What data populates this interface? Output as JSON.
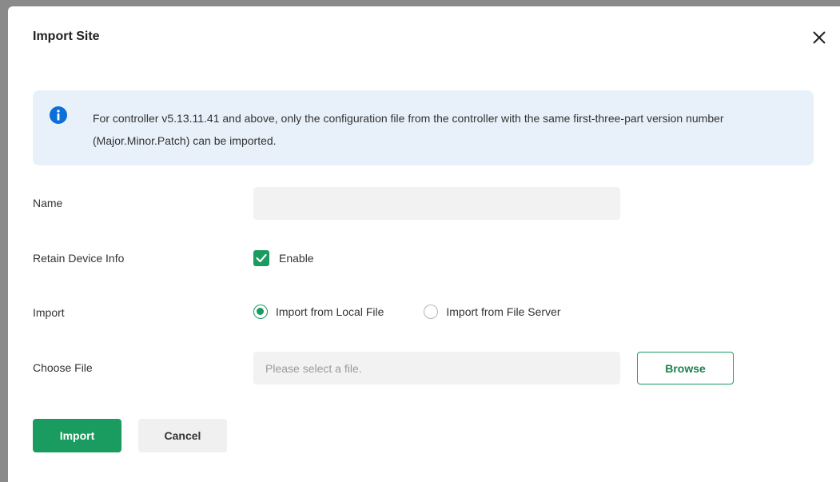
{
  "dialog": {
    "title": "Import Site",
    "close_icon": "close-icon"
  },
  "notice": {
    "icon": "info-icon",
    "text": "For controller v5.13.11.41 and above, only the configuration file from the controller with the same first-three-part version number (Major.Minor.Patch) can be imported."
  },
  "form": {
    "name": {
      "label": "Name",
      "value": "",
      "placeholder": ""
    },
    "retain_device_info": {
      "label": "Retain Device Info",
      "checkbox_label": "Enable",
      "checked": true
    },
    "import": {
      "label": "Import",
      "options": [
        {
          "label": "Import from Local File",
          "selected": true
        },
        {
          "label": "Import from File Server",
          "selected": false
        }
      ]
    },
    "choose_file": {
      "label": "Choose File",
      "placeholder": "Please select a file.",
      "value": "",
      "browse_label": "Browse"
    }
  },
  "footer": {
    "import_label": "Import",
    "cancel_label": "Cancel"
  },
  "colors": {
    "accent": "#1a9b5f",
    "info_background": "#e8f1fa",
    "info_icon": "#0a6fd8",
    "input_background": "#f2f2f2"
  }
}
